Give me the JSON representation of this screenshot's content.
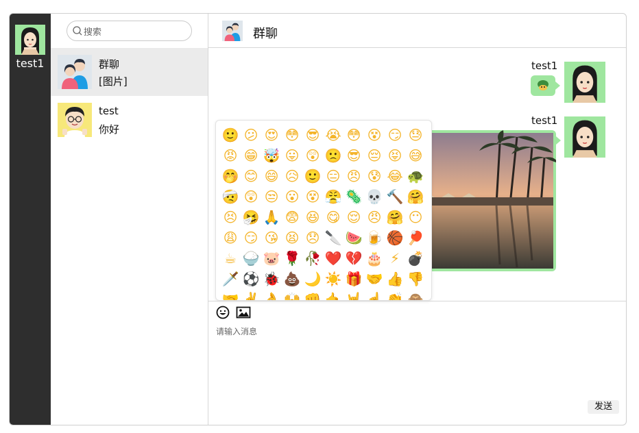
{
  "user": {
    "name": "test1",
    "avatar_icon": "girl-avatar-icon"
  },
  "search": {
    "placeholder": "搜索"
  },
  "conversations": [
    {
      "name": "群聊",
      "last_message": "[图片]",
      "avatar_icon": "group-avatar-icon",
      "active": true
    },
    {
      "name": "test",
      "last_message": "你好",
      "avatar_icon": "boy-avatar-icon",
      "active": false
    }
  ],
  "chat": {
    "title": "群聊",
    "title_icon": "group-avatar-icon"
  },
  "messages": [
    {
      "sender": "test1",
      "type": "emoji",
      "content_icon": "emoji-sticker-icon"
    },
    {
      "sender": "test1",
      "type": "image",
      "content_icon": "beach-photo"
    }
  ],
  "composer": {
    "placeholder": "请输入消息",
    "send_label": "发送",
    "emoji_tool_icon": "smiley-icon",
    "image_tool_icon": "image-icon"
  },
  "emojis": [
    "🙂",
    "😕",
    "😍",
    "😳",
    "😎",
    "😭",
    "😳",
    "😵",
    "😏",
    "😓",
    "😡",
    "😁",
    "🤯",
    "😛",
    "😲",
    "🙁",
    "😎",
    "😔",
    "😝",
    "😅",
    "🤭",
    "😊",
    "😄",
    "😥",
    "🙂",
    "😑",
    "😠",
    "😰",
    "😂",
    "🐢",
    "🤕",
    "😲",
    "😒",
    "😮",
    "😵",
    "😤",
    "🦠",
    "💀",
    "🔨",
    "🤗",
    "😣",
    "🤧",
    "🙏",
    "😨",
    "😆",
    "😋",
    "😌",
    "😠",
    "🤗",
    "😶",
    "😩",
    "😏",
    "😘",
    "😫",
    "😞",
    "🔪",
    "🍉",
    "🍺",
    "🏀",
    "🏓",
    "☕",
    "🍚",
    "🐷",
    "🌹",
    "🥀",
    "❤️",
    "💔",
    "🎂",
    "⚡",
    "💣",
    "🗡️",
    "⚽",
    "🐞",
    "💩",
    "🌙",
    "☀️",
    "🎁",
    "🤝",
    "👍",
    "👎",
    "🤝",
    "✌️",
    "👌",
    "🙌",
    "👊",
    "🤙",
    "🤘",
    "☝️",
    "👏",
    "🙈"
  ],
  "colors": {
    "rail": "#2e2e2e",
    "bubble": "#9fe69f",
    "active_item": "#ebebeb"
  }
}
